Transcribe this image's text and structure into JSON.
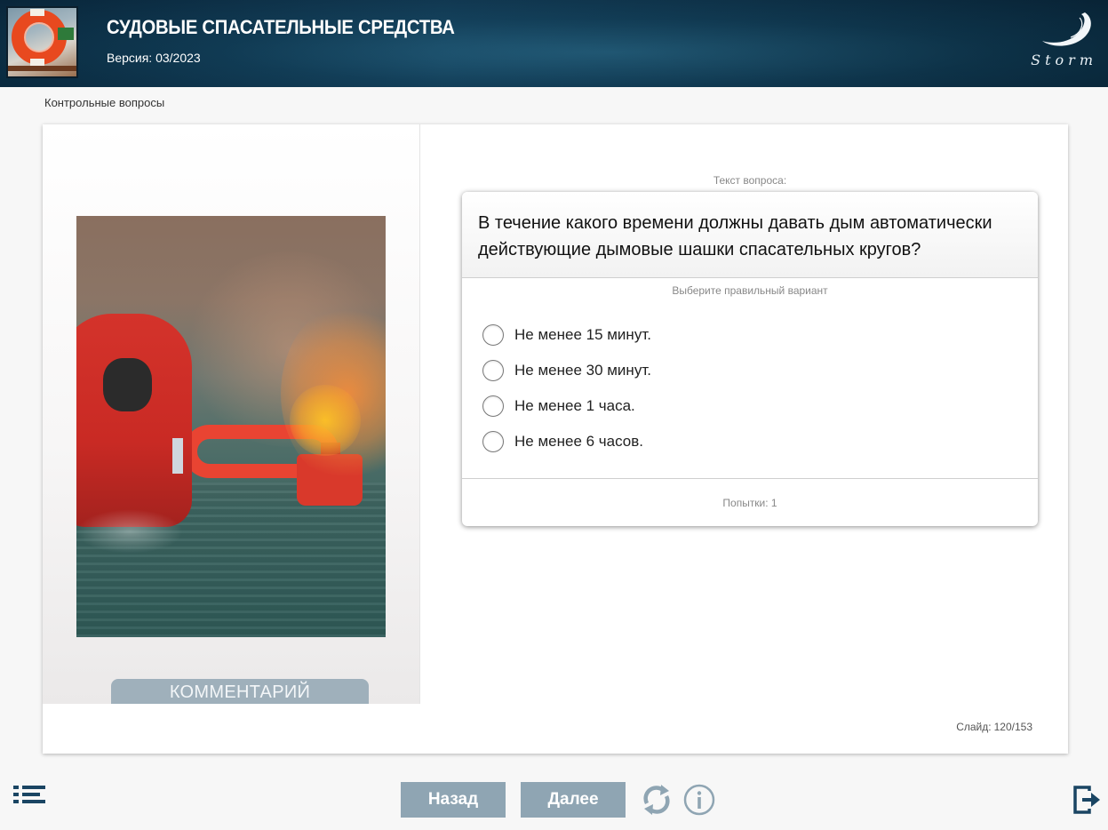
{
  "header": {
    "title": "СУДОВЫЕ СПАСАТЕЛЬНЫЕ СРЕДСТВА",
    "version": "Версия: 03/2023",
    "logo_text": "Storm"
  },
  "breadcrumb": "Контрольные вопросы",
  "left_panel": {
    "comment_button": "КОММЕНТАРИЙ"
  },
  "question": {
    "caption": "Текст вопроса:",
    "text": "В течение какого времени должны давать дым автоматически действующие дымовые шашки спасательных кругов?",
    "hint": "Выберите правильный вариант",
    "options": [
      "Не менее 15 минут.",
      "Не менее 30 минут.",
      "Не менее 1 часа.",
      "Не менее 6 часов."
    ],
    "attempts": "Попытки: 1"
  },
  "slide_counter": {
    "label": "Слайд:",
    "value": "120/153"
  },
  "nav": {
    "back_label": "Назад",
    "next_label": "Далее"
  },
  "icons": {
    "menu": "menu-list-icon",
    "reload": "reload-icon",
    "info": "info-icon",
    "exit": "exit-icon"
  },
  "colors": {
    "header_bg": "#0f3d58",
    "nav_button": "#8fa5b3",
    "comment_button": "#9fb0bb",
    "icon_dark": "#1a4563"
  }
}
